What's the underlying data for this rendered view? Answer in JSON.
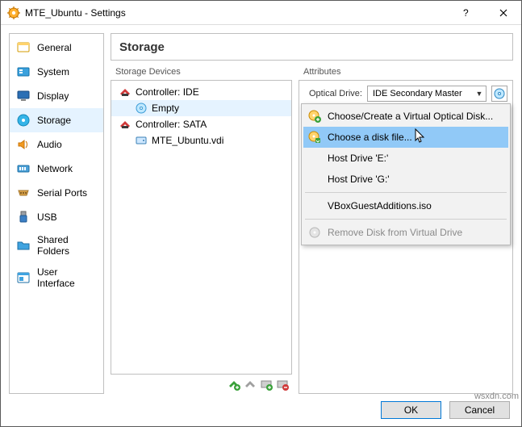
{
  "window": {
    "title": "MTE_Ubuntu - Settings"
  },
  "sidebar": {
    "items": [
      {
        "label": "General"
      },
      {
        "label": "System"
      },
      {
        "label": "Display"
      },
      {
        "label": "Storage"
      },
      {
        "label": "Audio"
      },
      {
        "label": "Network"
      },
      {
        "label": "Serial Ports"
      },
      {
        "label": "USB"
      },
      {
        "label": "Shared Folders"
      },
      {
        "label": "User Interface"
      }
    ]
  },
  "header": {
    "title": "Storage"
  },
  "devices": {
    "panel_title": "Storage Devices",
    "controllers": [
      {
        "label": "Controller: IDE",
        "children": [
          {
            "label": "Empty"
          }
        ]
      },
      {
        "label": "Controller: SATA",
        "children": [
          {
            "label": "MTE_Ubuntu.vdi"
          }
        ]
      }
    ]
  },
  "attributes": {
    "panel_title": "Attributes",
    "optical_label": "Optical Drive:",
    "optical_value": "IDE Secondary Master"
  },
  "menu": {
    "items": [
      {
        "label": "Choose/Create a Virtual Optical Disk..."
      },
      {
        "label": "Choose a disk file..."
      },
      {
        "label": "Host Drive 'E:'"
      },
      {
        "label": "Host Drive 'G:'"
      },
      {
        "label": "VBoxGuestAdditions.iso"
      },
      {
        "label": "Remove Disk from Virtual Drive"
      }
    ]
  },
  "buttons": {
    "ok": "OK",
    "cancel": "Cancel"
  },
  "watermark": "wsxdn.com"
}
